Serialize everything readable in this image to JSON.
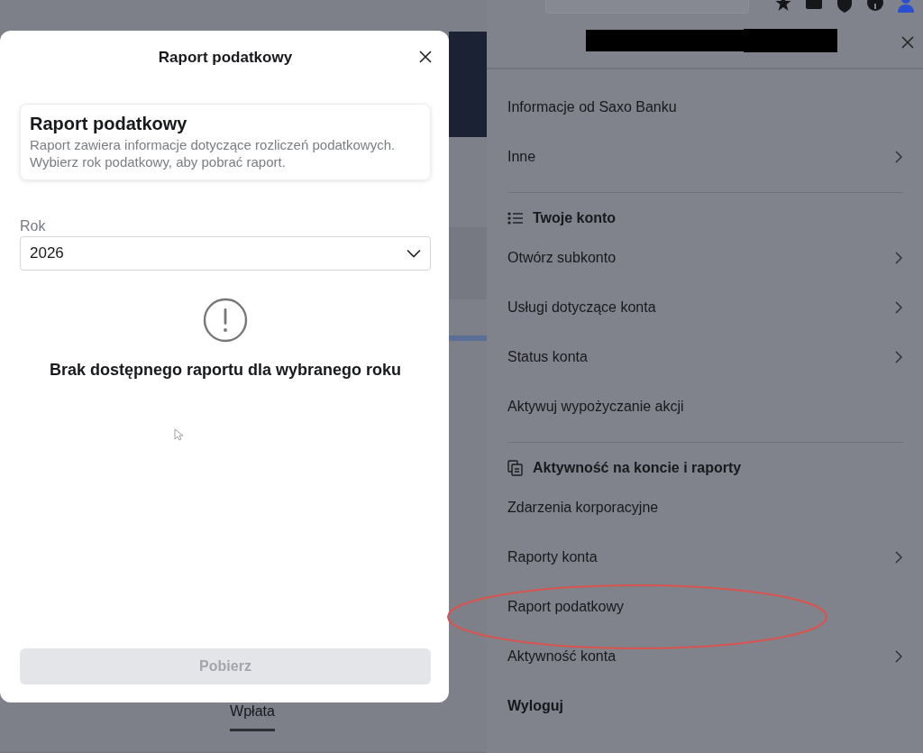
{
  "modal": {
    "title": "Raport podatkowy",
    "info": {
      "heading": "Raport podatkowy",
      "text": "Raport zawiera informacje dotyczące rozliczeń podatkowych. Wybierz rok podatkowy, aby pobrać raport."
    },
    "year_field": {
      "label": "Rok",
      "value": "2026"
    },
    "message": "Brak dostępnego raportu dla wybranego roku",
    "button": {
      "label": "Pobierz",
      "disabled": true
    }
  },
  "background": {
    "tabs": [
      {
        "label": "Wpłata",
        "selected": true
      }
    ]
  },
  "menu": {
    "groups": [
      {
        "items": [
          {
            "label": "Informacje od Saxo Banku",
            "has_submenu": false,
            "circled": false
          },
          {
            "label": "Inne",
            "has_submenu": true,
            "circled": false
          }
        ]
      },
      {
        "title": "Twoje konto",
        "items": [
          {
            "label": "Otwórz subkonto",
            "has_submenu": true,
            "circled": false
          },
          {
            "label": "Usługi dotyczące konta",
            "has_submenu": true,
            "circled": false
          },
          {
            "label": "Status konta",
            "has_submenu": true,
            "circled": false
          },
          {
            "label": "Aktywuj wypożyczanie akcji",
            "has_submenu": false,
            "circled": false
          }
        ]
      },
      {
        "title": "Aktywność na koncie i raporty",
        "items": [
          {
            "label": "Zdarzenia korporacyjne",
            "has_submenu": false,
            "circled": false
          },
          {
            "label": "Raporty konta",
            "has_submenu": true,
            "circled": false
          },
          {
            "label": "Raport podatkowy",
            "has_submenu": false,
            "circled": true
          },
          {
            "label": "Aktywność konta",
            "has_submenu": true,
            "circled": false
          }
        ]
      }
    ],
    "logout": "Wyloguj"
  }
}
